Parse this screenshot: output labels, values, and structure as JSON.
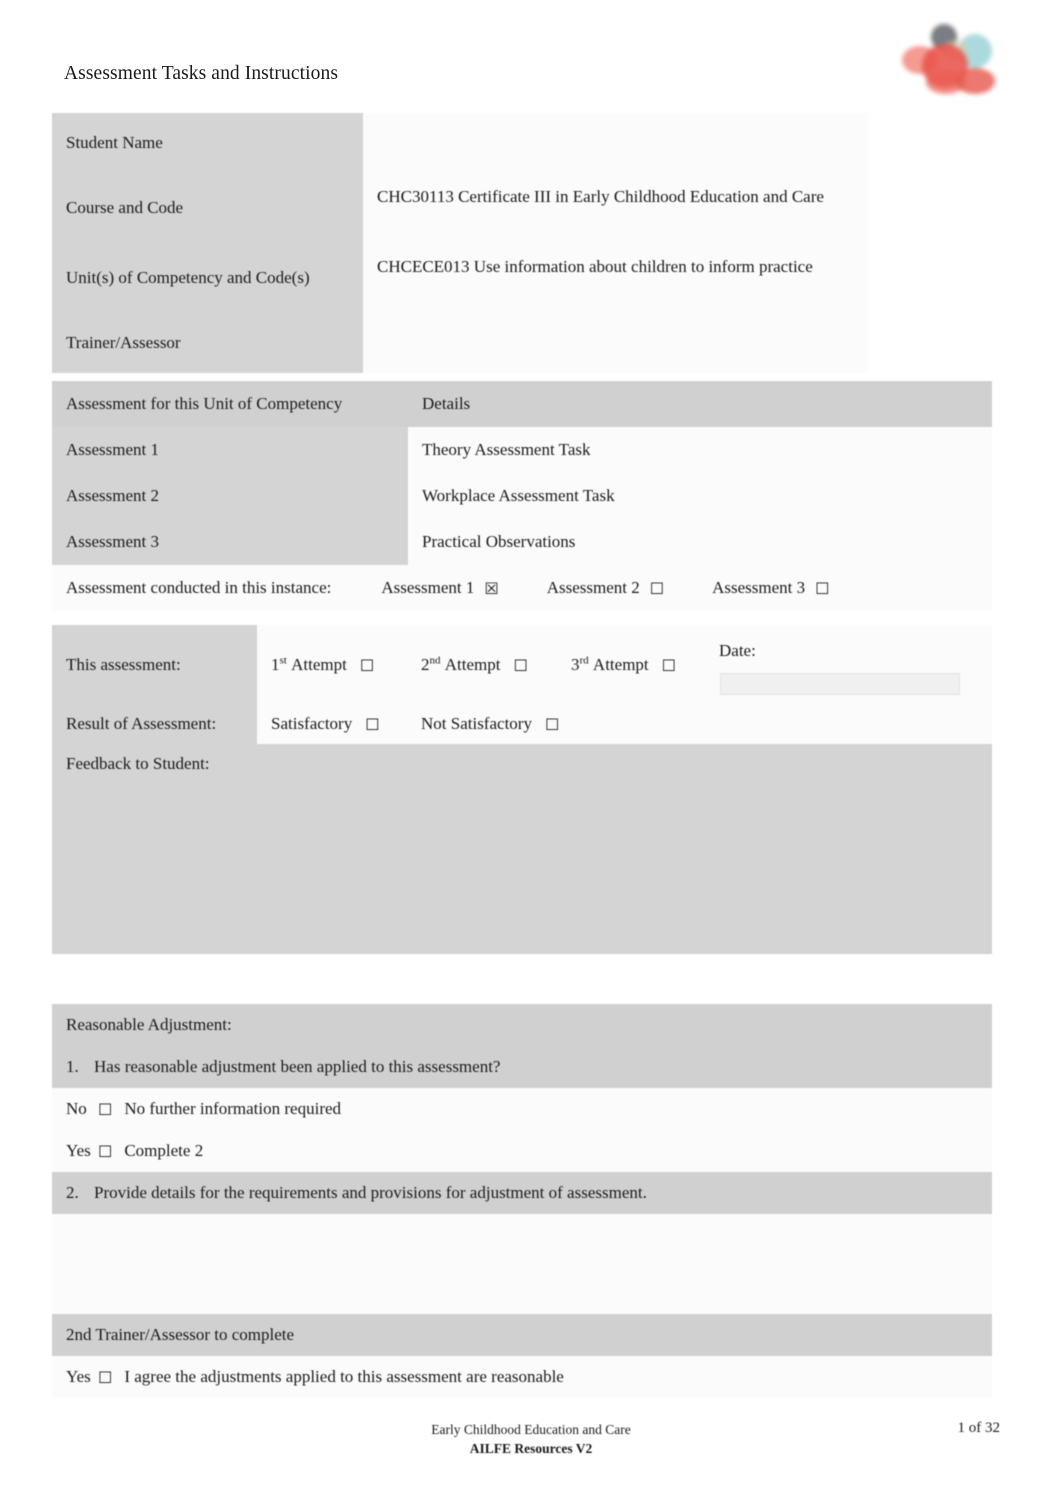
{
  "header": {
    "title": "Assessment Tasks and Instructions",
    "logo_icon": "ailfe-logo-icon"
  },
  "student_table": {
    "rows": [
      {
        "label": "Student Name",
        "value": ""
      },
      {
        "label": "Course and Code",
        "value": "CHC30113 Certificate III in Early Childhood Education and Care"
      },
      {
        "label": "Unit(s) of Competency and Code(s)",
        "value": "CHCECE013 Use information about children to inform practice"
      },
      {
        "label": "Trainer/Assessor",
        "value": ""
      }
    ]
  },
  "assessment_table": {
    "header": {
      "col1": "Assessment for this Unit of Competency",
      "col2": "Details"
    },
    "rows": [
      {
        "label": "Assessment 1",
        "detail": "Theory Assessment Task"
      },
      {
        "label": "Assessment 2",
        "detail": "Workplace Assessment Task"
      },
      {
        "label": "Assessment 3",
        "detail": "Practical Observations"
      }
    ],
    "conducted": {
      "label": "Assessment conducted in this instance:",
      "options": [
        {
          "label": "Assessment 1",
          "checkbox": "☒",
          "checked": true
        },
        {
          "label": "Assessment 2",
          "checkbox": "☐",
          "checked": false
        },
        {
          "label": "Assessment 3",
          "checkbox": "☐",
          "checked": false
        }
      ]
    }
  },
  "attempt_table": {
    "label": "This assessment:",
    "attempts": [
      {
        "ordinal": "1",
        "sup": "st",
        "text": "Attempt",
        "checkbox": "☐"
      },
      {
        "ordinal": "2",
        "sup": "nd",
        "text": "Attempt",
        "checkbox": "☐"
      },
      {
        "ordinal": "3",
        "sup": "rd",
        "text": "Attempt",
        "checkbox": "☐"
      }
    ],
    "date_label": "Date:",
    "date_value": "",
    "result_label": "Result of Assessment:",
    "result_options": [
      {
        "label": "Satisfactory",
        "checkbox": "☐"
      },
      {
        "label": "Not Satisfactory",
        "checkbox": "☐"
      }
    ],
    "feedback_label": "Feedback to Student:",
    "feedback_value": ""
  },
  "adjustment_table": {
    "title": "Reasonable Adjustment:",
    "q1_number": "1.",
    "q1_text": "Has reasonable adjustment been applied to this assessment?",
    "answer_no": {
      "prefix": "No",
      "checkbox": "☐",
      "text": "No further information required"
    },
    "answer_yes": {
      "prefix": "Yes",
      "checkbox": "☐",
      "text": "Complete 2"
    },
    "q2_number": "2.",
    "q2_text": "Provide details for the requirements and provisions for adjustment of assessment.",
    "q2_value": "",
    "second_trainer_title": "2nd Trainer/Assessor to complete",
    "second_trainer_agree": {
      "prefix": "Yes",
      "checkbox": "☐",
      "text": "I agree the adjustments applied to this assessment are reasonable"
    }
  },
  "footer": {
    "line1": "Early Childhood Education and Care",
    "line2": "AILFE Resources V2",
    "page": "1 of 32"
  },
  "colors": {
    "cell_gray": "#d4d4d4",
    "cell_white": "#fbfbfb",
    "text": "#1a1a1a",
    "logo_red": "#e8463c",
    "logo_teal": "#7fc4cc"
  }
}
